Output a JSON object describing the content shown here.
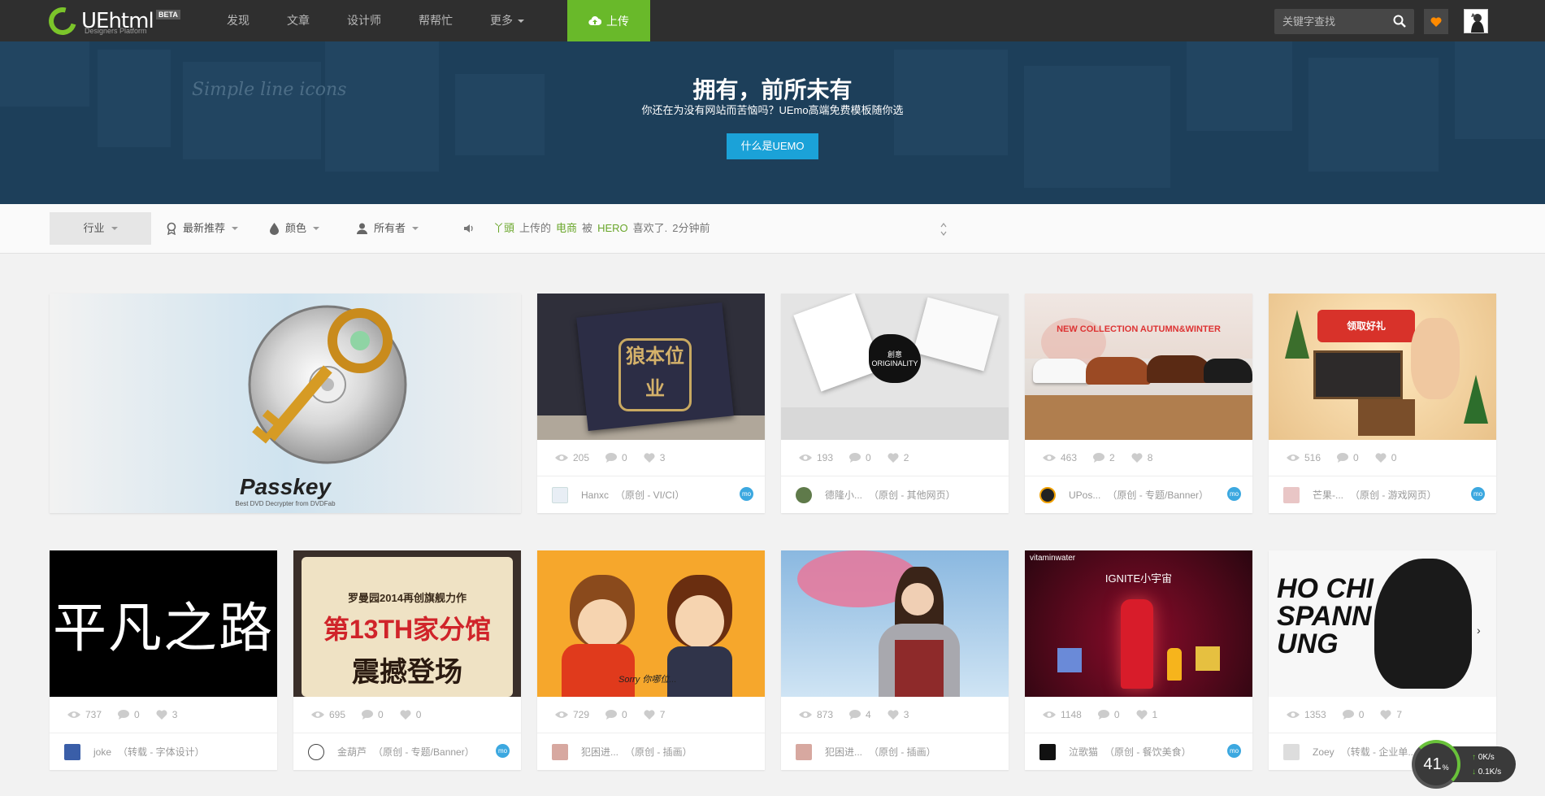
{
  "brand": {
    "logo_text": "UEhtml",
    "tagline": "Designers Platform",
    "badge": "BETA"
  },
  "nav": {
    "items": [
      {
        "label": "发现"
      },
      {
        "label": "文章"
      },
      {
        "label": "设计师"
      },
      {
        "label": "帮帮忙"
      },
      {
        "label": "更多"
      }
    ],
    "upload_label": "上传",
    "search_placeholder": "关键字查找"
  },
  "hero": {
    "title": "拥有，前所未有",
    "subtitle": "你还在为没有网站而苦恼吗？UEmo高端免费模板随你选",
    "button_label": "什么是UEMO",
    "bg_text": "Simple line icons"
  },
  "filters": {
    "industry": "行业",
    "sort": "最新推荐",
    "color": "颜色",
    "owner": "所有者"
  },
  "ticker": {
    "user": "丫頭",
    "uploaded": "上传的",
    "item": "电商",
    "by": "被",
    "liker": "HERO",
    "action": "喜欢了.",
    "time": "2分钟前"
  },
  "featured": {
    "title": "Passkey",
    "subtitle": "Best DVD Decrypter from DVDFab"
  },
  "cards": [
    {
      "views": "205",
      "comments": "0",
      "likes": "3",
      "author": "Hanxc",
      "meta": "（原创 - VI/CI）",
      "mo": "mo",
      "thumb_text": "狼本位业"
    },
    {
      "views": "193",
      "comments": "0",
      "likes": "2",
      "author": "德隆小...",
      "meta": "（原创 - 其他网页）",
      "thumb_text": "創意 ORIGINALITY"
    },
    {
      "views": "463",
      "comments": "2",
      "likes": "8",
      "author": "UPos...",
      "meta": "（原创 - 专题/Banner）",
      "mo": "mo",
      "thumb_text": "NEW COLLECTION AUTUMN&WINTER"
    },
    {
      "views": "516",
      "comments": "0",
      "likes": "0",
      "author": "芒果-...",
      "meta": "（原创 - 游戏网页）",
      "mo": "mo",
      "thumb_text": "领取好礼"
    },
    {
      "views": "737",
      "comments": "0",
      "likes": "3",
      "author": "joke",
      "meta": "（转载 - 字体设计）",
      "thumb_text": "平凡之路"
    },
    {
      "views": "695",
      "comments": "0",
      "likes": "0",
      "author": "金葫芦",
      "meta": "（原创 - 专题/Banner）",
      "mo": "mo",
      "thumb_text": "罗曼园2014再创旗舰力作",
      "thumb_text2": "第13TH家分馆",
      "thumb_text3": "震撼登场"
    },
    {
      "views": "729",
      "comments": "0",
      "likes": "7",
      "author": "犯困进...",
      "meta": "（原创 - 插画）",
      "thumb_text": "Sorry 你哪位..."
    },
    {
      "views": "873",
      "comments": "4",
      "likes": "3",
      "author": "犯困进...",
      "meta": "（原创 - 插画）"
    },
    {
      "views": "1148",
      "comments": "0",
      "likes": "1",
      "author": "泣歌猫",
      "meta": "（原创 - 餐饮美食）",
      "mo": "mo",
      "thumb_text": "IGNITE小宇宙",
      "thumb_text2": "vitaminwater"
    },
    {
      "views": "1353",
      "comments": "0",
      "likes": "7",
      "author": "Zoey",
      "meta": "（转载 - 企业单...",
      "thumb_text": "HO CHI SPANN UNG"
    }
  ],
  "speed": {
    "percent": "41",
    "unit": "%",
    "up": "0K/s",
    "down": "0.1K/s"
  },
  "colors": {
    "accent_green": "#69b92a",
    "hero_blue": "#1ba2d8",
    "topbar": "#2f2f2f"
  }
}
